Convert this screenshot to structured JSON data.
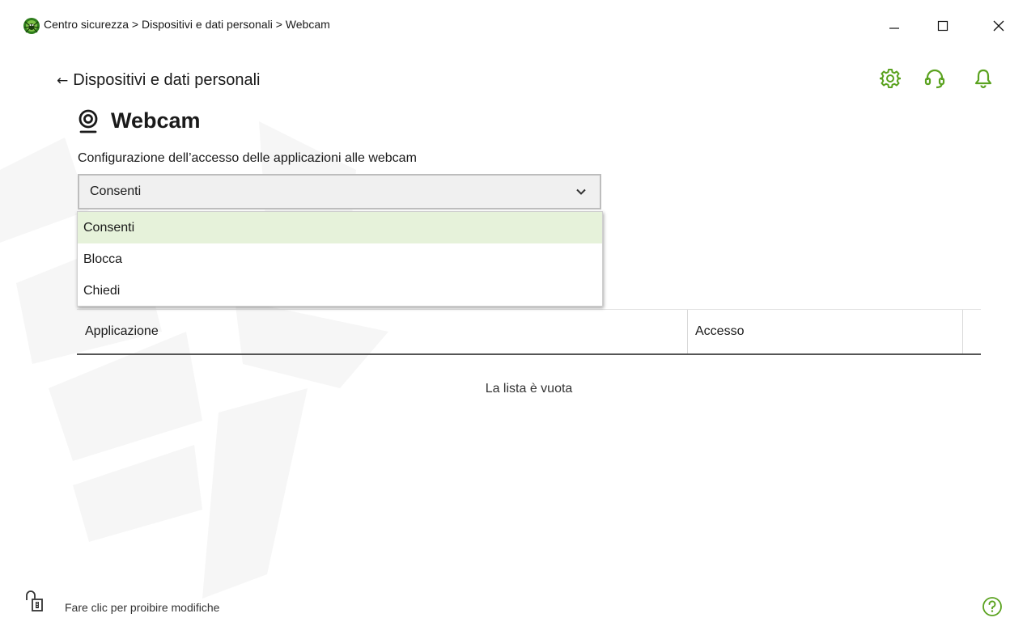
{
  "window": {
    "title": "Centro sicurezza > Dispositivi e dati personali > Webcam",
    "logo_icon": "dr-web-spider-logo-icon",
    "controls": {
      "minimize_icon": "minimize-icon",
      "maximize_icon": "maximize-icon",
      "close_icon": "close-icon"
    }
  },
  "header": {
    "back_label": "Dispositivi e dati personali",
    "back_arrow": "←",
    "icons": [
      "gear-icon",
      "headset-icon",
      "bell-icon"
    ]
  },
  "page": {
    "title": "Webcam",
    "title_icon": "webcam-icon",
    "section_label": "Configurazione dell’accesso delle applicazioni alle webcam"
  },
  "select": {
    "value": "Consenti",
    "options": [
      {
        "label": "Consenti",
        "selected": true
      },
      {
        "label": "Blocca",
        "selected": false
      },
      {
        "label": "Chiedi",
        "selected": false
      }
    ]
  },
  "table": {
    "columns": [
      "Applicazione",
      "Accesso"
    ],
    "empty_message": "La lista è vuota"
  },
  "footer": {
    "lock_label": "Fare clic per proibire modifiche",
    "lock_icon": "padlock-open-icon",
    "help_icon": "help-icon"
  },
  "colors": {
    "accent_green": "#5aa21f",
    "selected_item_bg": "#e6f2da",
    "select_bg": "#f0f0f0"
  }
}
